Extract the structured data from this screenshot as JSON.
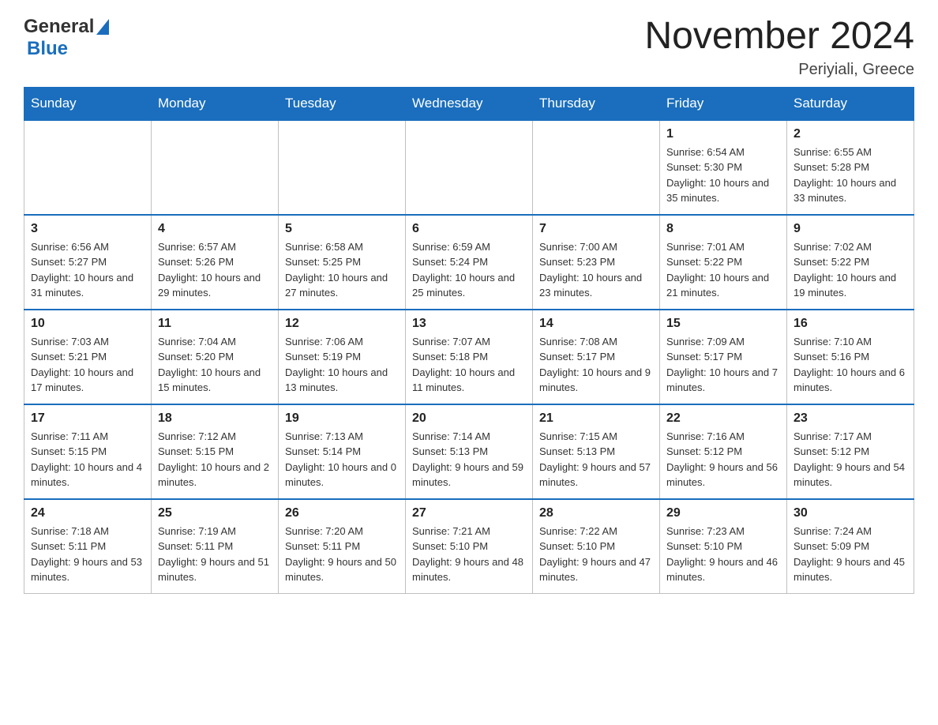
{
  "header": {
    "logo_general": "General",
    "logo_blue": "Blue",
    "title": "November 2024",
    "subtitle": "Periyiali, Greece"
  },
  "days_of_week": [
    "Sunday",
    "Monday",
    "Tuesday",
    "Wednesday",
    "Thursday",
    "Friday",
    "Saturday"
  ],
  "weeks": [
    {
      "cells": [
        {
          "day": "",
          "info": ""
        },
        {
          "day": "",
          "info": ""
        },
        {
          "day": "",
          "info": ""
        },
        {
          "day": "",
          "info": ""
        },
        {
          "day": "",
          "info": ""
        },
        {
          "day": "1",
          "info": "Sunrise: 6:54 AM\nSunset: 5:30 PM\nDaylight: 10 hours and 35 minutes."
        },
        {
          "day": "2",
          "info": "Sunrise: 6:55 AM\nSunset: 5:28 PM\nDaylight: 10 hours and 33 minutes."
        }
      ]
    },
    {
      "cells": [
        {
          "day": "3",
          "info": "Sunrise: 6:56 AM\nSunset: 5:27 PM\nDaylight: 10 hours and 31 minutes."
        },
        {
          "day": "4",
          "info": "Sunrise: 6:57 AM\nSunset: 5:26 PM\nDaylight: 10 hours and 29 minutes."
        },
        {
          "day": "5",
          "info": "Sunrise: 6:58 AM\nSunset: 5:25 PM\nDaylight: 10 hours and 27 minutes."
        },
        {
          "day": "6",
          "info": "Sunrise: 6:59 AM\nSunset: 5:24 PM\nDaylight: 10 hours and 25 minutes."
        },
        {
          "day": "7",
          "info": "Sunrise: 7:00 AM\nSunset: 5:23 PM\nDaylight: 10 hours and 23 minutes."
        },
        {
          "day": "8",
          "info": "Sunrise: 7:01 AM\nSunset: 5:22 PM\nDaylight: 10 hours and 21 minutes."
        },
        {
          "day": "9",
          "info": "Sunrise: 7:02 AM\nSunset: 5:22 PM\nDaylight: 10 hours and 19 minutes."
        }
      ]
    },
    {
      "cells": [
        {
          "day": "10",
          "info": "Sunrise: 7:03 AM\nSunset: 5:21 PM\nDaylight: 10 hours and 17 minutes."
        },
        {
          "day": "11",
          "info": "Sunrise: 7:04 AM\nSunset: 5:20 PM\nDaylight: 10 hours and 15 minutes."
        },
        {
          "day": "12",
          "info": "Sunrise: 7:06 AM\nSunset: 5:19 PM\nDaylight: 10 hours and 13 minutes."
        },
        {
          "day": "13",
          "info": "Sunrise: 7:07 AM\nSunset: 5:18 PM\nDaylight: 10 hours and 11 minutes."
        },
        {
          "day": "14",
          "info": "Sunrise: 7:08 AM\nSunset: 5:17 PM\nDaylight: 10 hours and 9 minutes."
        },
        {
          "day": "15",
          "info": "Sunrise: 7:09 AM\nSunset: 5:17 PM\nDaylight: 10 hours and 7 minutes."
        },
        {
          "day": "16",
          "info": "Sunrise: 7:10 AM\nSunset: 5:16 PM\nDaylight: 10 hours and 6 minutes."
        }
      ]
    },
    {
      "cells": [
        {
          "day": "17",
          "info": "Sunrise: 7:11 AM\nSunset: 5:15 PM\nDaylight: 10 hours and 4 minutes."
        },
        {
          "day": "18",
          "info": "Sunrise: 7:12 AM\nSunset: 5:15 PM\nDaylight: 10 hours and 2 minutes."
        },
        {
          "day": "19",
          "info": "Sunrise: 7:13 AM\nSunset: 5:14 PM\nDaylight: 10 hours and 0 minutes."
        },
        {
          "day": "20",
          "info": "Sunrise: 7:14 AM\nSunset: 5:13 PM\nDaylight: 9 hours and 59 minutes."
        },
        {
          "day": "21",
          "info": "Sunrise: 7:15 AM\nSunset: 5:13 PM\nDaylight: 9 hours and 57 minutes."
        },
        {
          "day": "22",
          "info": "Sunrise: 7:16 AM\nSunset: 5:12 PM\nDaylight: 9 hours and 56 minutes."
        },
        {
          "day": "23",
          "info": "Sunrise: 7:17 AM\nSunset: 5:12 PM\nDaylight: 9 hours and 54 minutes."
        }
      ]
    },
    {
      "cells": [
        {
          "day": "24",
          "info": "Sunrise: 7:18 AM\nSunset: 5:11 PM\nDaylight: 9 hours and 53 minutes."
        },
        {
          "day": "25",
          "info": "Sunrise: 7:19 AM\nSunset: 5:11 PM\nDaylight: 9 hours and 51 minutes."
        },
        {
          "day": "26",
          "info": "Sunrise: 7:20 AM\nSunset: 5:11 PM\nDaylight: 9 hours and 50 minutes."
        },
        {
          "day": "27",
          "info": "Sunrise: 7:21 AM\nSunset: 5:10 PM\nDaylight: 9 hours and 48 minutes."
        },
        {
          "day": "28",
          "info": "Sunrise: 7:22 AM\nSunset: 5:10 PM\nDaylight: 9 hours and 47 minutes."
        },
        {
          "day": "29",
          "info": "Sunrise: 7:23 AM\nSunset: 5:10 PM\nDaylight: 9 hours and 46 minutes."
        },
        {
          "day": "30",
          "info": "Sunrise: 7:24 AM\nSunset: 5:09 PM\nDaylight: 9 hours and 45 minutes."
        }
      ]
    }
  ]
}
